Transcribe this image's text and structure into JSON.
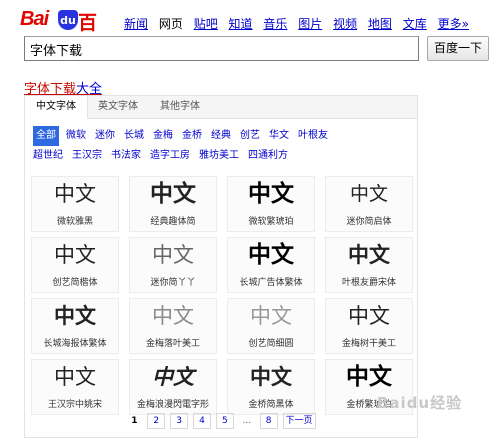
{
  "logo": {
    "bai": "Bai",
    "paw": "du",
    "baidu": "百度"
  },
  "nav": {
    "items": [
      {
        "label": "新闻",
        "active": false
      },
      {
        "label": "网页",
        "active": true
      },
      {
        "label": "贴吧",
        "active": false
      },
      {
        "label": "知道",
        "active": false
      },
      {
        "label": "音乐",
        "active": false
      },
      {
        "label": "图片",
        "active": false
      },
      {
        "label": "视频",
        "active": false
      },
      {
        "label": "地图",
        "active": false
      },
      {
        "label": "文库",
        "active": false
      },
      {
        "label": "更多»",
        "active": false
      }
    ]
  },
  "search": {
    "value": "字体下载",
    "button_label": "百度一下"
  },
  "result": {
    "title_highlight": "字体下载",
    "title_rest": "大全"
  },
  "panel": {
    "tabs": [
      "中文字体",
      "英文字体",
      "其他字体"
    ],
    "filters_row1": [
      "全部",
      "微软",
      "迷你",
      "长城",
      "金梅",
      "金桥",
      "经典",
      "创艺",
      "华文",
      "叶根友"
    ],
    "filters_row2": [
      "超世纪",
      "王汉宗",
      "书法家",
      "造字工房",
      "雅坊美工",
      "四通利方"
    ],
    "cards": [
      {
        "glyph": "中文",
        "name": "微软雅黑"
      },
      {
        "glyph": "中文",
        "name": "经典趣体简"
      },
      {
        "glyph": "中文",
        "name": "微软繁琥珀"
      },
      {
        "glyph": "中文",
        "name": "迷你简启体"
      },
      {
        "glyph": "中文",
        "name": "创艺简楷体"
      },
      {
        "glyph": "中文",
        "name": "迷你简丫丫"
      },
      {
        "glyph": "中文",
        "name": "长城广告体繁体"
      },
      {
        "glyph": "中文",
        "name": "叶根友爵宋体"
      },
      {
        "glyph": "中文",
        "name": "长城海报体繁体"
      },
      {
        "glyph": "中文",
        "name": "金梅落叶美工"
      },
      {
        "glyph": "中文",
        "name": "创艺简细圆"
      },
      {
        "glyph": "中文",
        "name": "金梅树干美工"
      },
      {
        "glyph": "中文",
        "name": "王汉宗中姚宋"
      },
      {
        "glyph": "中文",
        "name": "金梅浪漫閃電字形"
      },
      {
        "glyph": "中文",
        "name": "金桥简黑体"
      },
      {
        "glyph": "中文",
        "name": "金桥繁琥珀"
      }
    ],
    "pager": {
      "pages": [
        "1",
        "2",
        "3",
        "4",
        "5"
      ],
      "dots": "...",
      "last": "8",
      "next": "下一页"
    }
  },
  "watermark": "Baidu经验"
}
